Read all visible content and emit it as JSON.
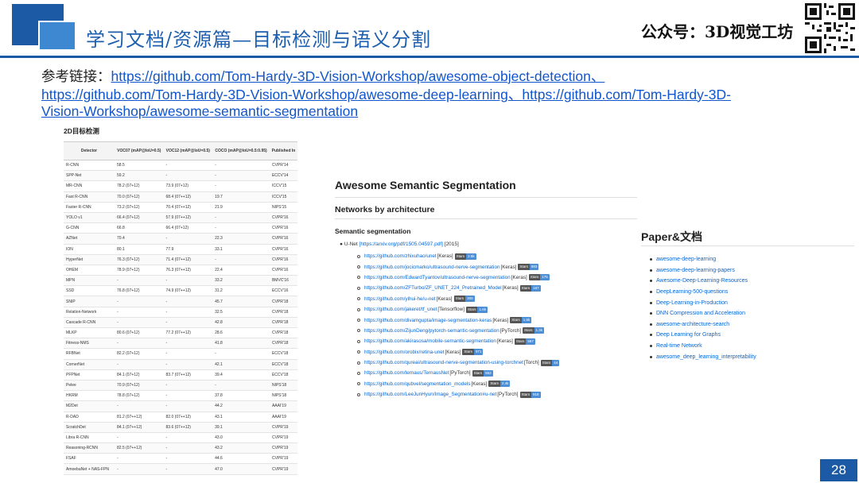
{
  "header": {
    "title": "学习文档/资源篇—目标检测与语义分割",
    "account": "公众号：3D视觉工坊"
  },
  "links": {
    "prefix": "参考链接：",
    "link1": "https://github.com/Tom-Hardy-3D-Vision-Workshop/awesome-object-detection",
    "sep1": "、",
    "link2": "https://github.com/Tom-Hardy-3D-Vision-Workshop/awesome-deep-learning",
    "sep2": "、",
    "link3": "https://github.com/Tom-Hardy-3D-Vision-Workshop/awesome-semantic-segmentation"
  },
  "detection_table": {
    "caption": "2D目标检测",
    "columns": [
      "Detector",
      "VOC07 (mAP@IoU=0.5)",
      "VOC12 (mAP@IoU=0.5)",
      "COCO (mAP@IoU=0.5:0.95)",
      "Published In"
    ],
    "rows": [
      [
        "R-CNN",
        "58.5",
        "-",
        "-",
        "CVPR'14"
      ],
      [
        "SPP-Net",
        "59.2",
        "-",
        "-",
        "ECCV'14"
      ],
      [
        "MR-CNN",
        "78.2 (07+12)",
        "73.9 (07+12)",
        "-",
        "ICCV'15"
      ],
      [
        "Fast R-CNN",
        "70.0 (07+12)",
        "68.4 (07++12)",
        "19.7",
        "ICCV'15"
      ],
      [
        "Faster R-CNN",
        "73.2 (07+12)",
        "70.4 (07++12)",
        "21.9",
        "NIPS'15"
      ],
      [
        "YOLO v1",
        "66.4 (07+12)",
        "57.9 (07++12)",
        "-",
        "CVPR'16"
      ],
      [
        "G-CNN",
        "66.8",
        "66.4 (07+12)",
        "-",
        "CVPR'16"
      ],
      [
        "AZNet",
        "70.4",
        "-",
        "22.3",
        "CVPR'16"
      ],
      [
        "ION",
        "80.1",
        "77.9",
        "33.1",
        "CVPR'16"
      ],
      [
        "HyperNet",
        "76.3 (07+12)",
        "71.4 (07++12)",
        "-",
        "CVPR'16"
      ],
      [
        "OHEM",
        "78.9 (07+12)",
        "76.3 (07++12)",
        "22.4",
        "CVPR'16"
      ],
      [
        "MPN",
        "-",
        "-",
        "33.2",
        "BMVC'16"
      ],
      [
        "SSD",
        "76.8 (07+12)",
        "74.9 (07++12)",
        "31.2",
        "ECCV'16"
      ],
      [
        "SNIP",
        "-",
        "-",
        "45.7",
        "CVPR'18"
      ],
      [
        "Relation-Network",
        "-",
        "-",
        "32.5",
        "CVPR'18"
      ],
      [
        "Cascade R-CNN",
        "-",
        "-",
        "42.8",
        "CVPR'18"
      ],
      [
        "MLKP",
        "80.6 (07+12)",
        "77.2 (07++12)",
        "28.6",
        "CVPR'18"
      ],
      [
        "Fitness-NMS",
        "-",
        "-",
        "41.8",
        "CVPR'18"
      ],
      [
        "RFBNet",
        "82.2 (07+12)",
        "-",
        "-",
        "ECCV'18"
      ],
      [
        "CornerNet",
        "-",
        "-",
        "42.1",
        "ECCV'18"
      ],
      [
        "PFPNet",
        "84.1 (07+12)",
        "83.7 (07++12)",
        "39.4",
        "ECCV'18"
      ],
      [
        "Pelee",
        "70.9 (07+12)",
        "-",
        "-",
        "NIPS'18"
      ],
      [
        "HKRM",
        "78.8 (07+12)",
        "-",
        "37.8",
        "NIPS'18"
      ],
      [
        "M2Det",
        "-",
        "-",
        "44.2",
        "AAAI'19"
      ],
      [
        "R-DAD",
        "81.2 (07++12)",
        "82.0 (07++12)",
        "43.1",
        "AAAI'19"
      ],
      [
        "ScratchDet",
        "84.1 (07++12)",
        "83.6 (07++12)",
        "39.1",
        "CVPR'19"
      ],
      [
        "Libra R-CNN",
        "-",
        "-",
        "43.0",
        "CVPR'19"
      ],
      [
        "Reasoning-RCNN",
        "82.5 (07++12)",
        "-",
        "43.2",
        "CVPR'19"
      ],
      [
        "FSAF",
        "-",
        "-",
        "44.6",
        "CVPR'19"
      ],
      [
        "AmoebaNet + NAS-FPN",
        "-",
        "-",
        "47.0",
        "CVPR'19"
      ]
    ]
  },
  "segmentation": {
    "title": "Awesome Semantic Segmentation",
    "subtitle": "Networks by architecture",
    "section": "Semantic segmentation",
    "unet_label": "U-Net",
    "unet_paper": "[https://arxiv.org/pdf/1505.04597.pdf]",
    "unet_year": "[2015]",
    "items": [
      {
        "url": "https://github.com/zhixuhao/unet",
        "fw": "[Keras]",
        "stars": "2.8k"
      },
      {
        "url": "https://github.com/jocicmarko/ultrasound-nerve-segmentation",
        "fw": "[Keras]",
        "stars": "883"
      },
      {
        "url": "https://github.com/EdwardTyantov/ultrasound-nerve-segmentation",
        "fw": "[Keras]",
        "stars": "175"
      },
      {
        "url": "https://github.com/ZFTurbo/ZF_UNET_224_Pretrained_Model",
        "fw": "[Keras]",
        "stars": "187"
      },
      {
        "url": "https://github.com/yihui-he/u-net",
        "fw": "[Keras]",
        "stars": "309"
      },
      {
        "url": "https://github.com/jakeret/tf_unet",
        "fw": "[Tensorflow]",
        "stars": "1.6k"
      },
      {
        "url": "https://github.com/divamgupta/image-segmentation-keras",
        "fw": "[Keras]",
        "stars": "1.5k"
      },
      {
        "url": "https://github.com/ZijunDeng/pytorch-semantic-segmentation",
        "fw": "[PyTorch]",
        "stars": "1.3k"
      },
      {
        "url": "https://github.com/akirasosa/mobile-semantic-segmentation",
        "fw": "[Keras]",
        "stars": "587"
      },
      {
        "url": "https://github.com/orobix/retina-unet",
        "fw": "[Keras]",
        "stars": "971"
      },
      {
        "url": "https://github.com/qureai/ultrasound-nerve-segmentation-using-torchnet",
        "fw": "[Torch]",
        "stars": "44"
      },
      {
        "url": "https://github.com/ternaus/TernausNet",
        "fw": "[PyTorch]",
        "stars": "862"
      },
      {
        "url": "https://github.com/qubvel/segmentation_models",
        "fw": "[Keras]",
        "stars": "2.4k"
      },
      {
        "url": "https://github.com/LeeJunHyun/Image_Segmentation#u-net",
        "fw": "[PyTorch]",
        "stars": "918"
      }
    ],
    "stars_label": "Stars"
  },
  "paper": {
    "title": "Paper&文档",
    "items": [
      "awesome-deep-learning",
      "awesome-deep-learning-papers",
      "Awesome-Deep-Learning-Resources",
      "DeepLearning-500-questions",
      "Deep-Learning-in-Production",
      "DNN Compression and Acceleration",
      "awesome-architecture-search",
      "Deep Learning for Graphs",
      "Real-time Network",
      "awesome_deep_learning_interpretability"
    ]
  },
  "page_number": "28",
  "colors": {
    "brand_blue": "#1c5aa6",
    "light_blue": "#3d88d0",
    "link_blue": "#1155cc"
  }
}
